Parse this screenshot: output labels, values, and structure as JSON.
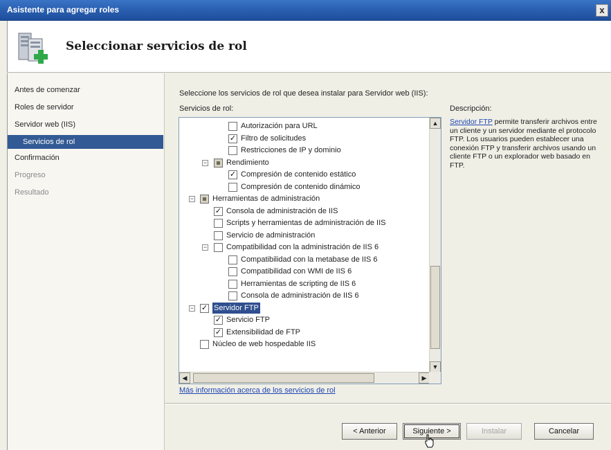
{
  "window": {
    "title": "Asistente para agregar roles",
    "close_glyph": "x"
  },
  "header": {
    "page_title": "Seleccionar servicios de rol",
    "icon": "server-roles-add-icon"
  },
  "nav": [
    {
      "label": "Antes de comenzar",
      "state": "normal"
    },
    {
      "label": "Roles de servidor",
      "state": "normal"
    },
    {
      "label": "Servidor web (IIS)",
      "state": "normal"
    },
    {
      "label": "Servicios de rol",
      "state": "selected"
    },
    {
      "label": "Confirmación",
      "state": "normal"
    },
    {
      "label": "Progreso",
      "state": "disabled"
    },
    {
      "label": "Resultado",
      "state": "disabled"
    }
  ],
  "main": {
    "instruction": "Seleccione los servicios de rol que desea instalar para Servidor web (IIS):",
    "services_label": "Servicios de rol:",
    "description_title": "Descripción:",
    "description_link": "Servidor FTP",
    "description_body": " permite transferir archivos entre un cliente y un servidor mediante el protocolo FTP. Los usuarios pueden establecer una conexión FTP y transferir archivos usando un cliente FTP o un explorador web basado en FTP.",
    "more_info_link": "Más información acerca de los servicios de rol"
  },
  "tree": [
    {
      "label": "Autorización para URL",
      "level": 3,
      "checked": false
    },
    {
      "label": "Filtro de solicitudes",
      "level": 3,
      "checked": true
    },
    {
      "label": "Restricciones de IP y dominio",
      "level": 3,
      "checked": false
    },
    {
      "label": "Rendimiento",
      "level": 2,
      "checked": "partial",
      "expander": "−"
    },
    {
      "label": "Compresión de contenido estático",
      "level": 3,
      "checked": true
    },
    {
      "label": "Compresión de contenido dinámico",
      "level": 3,
      "checked": false
    },
    {
      "label": "Herramientas de administración",
      "level": 1,
      "checked": "partial",
      "expander": "−"
    },
    {
      "label": "Consola de administración de IIS",
      "level": 2,
      "checked": true
    },
    {
      "label": "Scripts y herramientas de administración de IIS",
      "level": 2,
      "checked": false
    },
    {
      "label": "Servicio de administración",
      "level": 2,
      "checked": false
    },
    {
      "label": "Compatibilidad con la administración de IIS 6",
      "level": 2,
      "checked": false,
      "expander": "−"
    },
    {
      "label": "Compatibilidad con la metabase de IIS 6",
      "level": 3,
      "checked": false
    },
    {
      "label": "Compatibilidad con WMI de IIS 6",
      "level": 3,
      "checked": false
    },
    {
      "label": "Herramientas de scripting de IIS 6",
      "level": 3,
      "checked": false
    },
    {
      "label": "Consola de administración de IIS 6",
      "level": 3,
      "checked": false
    },
    {
      "label": "Servidor FTP",
      "level": 1,
      "checked": true,
      "expander": "−",
      "selected": true
    },
    {
      "label": "Servicio FTP",
      "level": 2,
      "checked": true
    },
    {
      "label": "Extensibilidad de FTP",
      "level": 2,
      "checked": true
    },
    {
      "label": "Núcleo de web hospedable IIS",
      "level": 1,
      "checked": false
    }
  ],
  "buttons": {
    "back": "< Anterior",
    "next": "Siguiente >",
    "install": "Instalar",
    "cancel": "Cancelar"
  },
  "colors": {
    "titlebar": "#2a5fb0",
    "nav_selected": "#325a94",
    "link": "#1e46b4"
  }
}
